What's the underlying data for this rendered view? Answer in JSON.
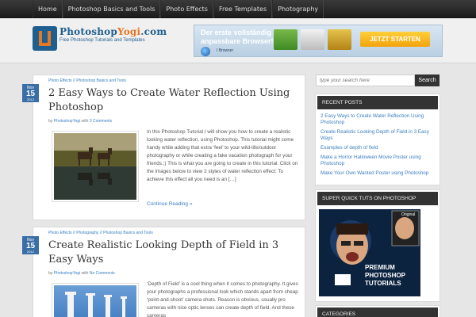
{
  "nav": {
    "items": [
      "Home",
      "Photoshop Basics and Tools",
      "Photo Effects",
      "Free Templates",
      "Photography"
    ]
  },
  "logo": {
    "title_main": "Photoshop",
    "title_accent": "Yogi",
    "title_suffix": ".com",
    "subtitle": "Free Photoshop Tutorials and Templates"
  },
  "banner": {
    "line1": "Der erste vollständig",
    "line2": "anpassbare Browser!",
    "brand": "I Browser",
    "cta": "JETZT STARTEN"
  },
  "posts": [
    {
      "date": {
        "month": "Nov",
        "day": "15",
        "year": "2012"
      },
      "categories": "Photo Effects // Photoshop Basics and Tools",
      "title": "2 Easy Ways to Create Water Reflection Using Photoshop",
      "meta_by": "by",
      "author": "PhotoshopYogi",
      "meta_with": "with",
      "comments": "3 Comments",
      "excerpt": "In this Photoshop Tutorial I will show you how to create a realistic looking water reflection, using Photoshop. This tutorial might come handy while adding that extra ‘feel’ to your wild-life/outdoor photography or while creating a fake vacation photograph for your friends.;) This is what you are going to create in this tutorial. Click on the images below to view 2 styles of water reflection effect: To achieve this effect all you need is an […]",
      "more": "Continue Reading »"
    },
    {
      "date": {
        "month": "Nov",
        "day": "15",
        "year": "2012"
      },
      "categories": "Photo Effects // Photography // Photoshop Basics and Tools",
      "title": "Create Realistic Looking Depth of Field in 3 Easy Ways",
      "meta_by": "by",
      "author": "PhotoshopYogi",
      "meta_with": "with",
      "comments": "No Comments",
      "excerpt": "‘Depth of Field’ is a cool thing when it comes to photography. It gives your photographs a professional look which stands apart from cheap ‘point-and-shoot’ camera shots. Reason is obvious, usually pro cameras with nice optic lenses can create depth of field. And these cameras"
    }
  ],
  "sidebar": {
    "search_placeholder": "type your search here",
    "search_button": "Search",
    "recent_title": "RECENT POSTS",
    "recent": [
      "2 Easy Ways to Create Water Reflection Using Photoshop",
      "Create Realistic Looking Depth of Field in 3 Easy Ways",
      "Examples of depth of field",
      "Make a Horror Halloween Movie Poster using Photoshop",
      "Make Your Own Wanted Poster using Photoshop"
    ],
    "quick_title": "SUPER QUICK TUTS ON PHOTOSHOP",
    "quick_image_caption_top": "Original",
    "quick_image_caption": "PREMIUM PHOTOSHOP TUTORIALS",
    "categories_title": "CATEGORIES"
  },
  "colors": {
    "accent": "#3a7fc1",
    "brand": "#1f5f8f",
    "orange": "#e87722",
    "dark": "#333333"
  }
}
